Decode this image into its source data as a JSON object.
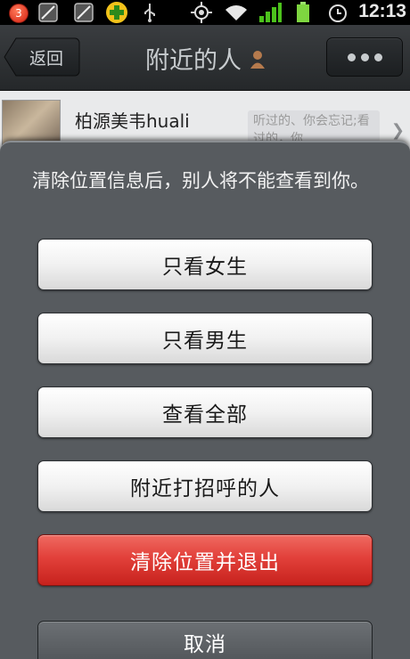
{
  "status_bar": {
    "notification_count": "3",
    "time": "12:13",
    "icons": [
      "notification-badge",
      "app-icon",
      "app-icon",
      "plus-app-icon",
      "usb-icon",
      "gps-icon",
      "wifi-icon",
      "signal-icon",
      "battery-icon",
      "alarm-icon"
    ]
  },
  "header": {
    "back_label": "返回",
    "title": "附近的人",
    "title_icon": "avatar-icon",
    "more_icon": "more-icon"
  },
  "list": {
    "first_item": {
      "name": "柏源美韦huali",
      "signature": "听过的、你会忘记;看过的，你"
    }
  },
  "dialog": {
    "message": "清除位置信息后，别人将不能查看到你。",
    "buttons": [
      "只看女生",
      "只看男生",
      "查看全部",
      "附近打招呼的人",
      "清除位置并退出",
      "取消"
    ]
  },
  "colors": {
    "danger_button": "#e2403a",
    "dialog_background": "#575b5f",
    "titlebar": "#2e3134"
  }
}
